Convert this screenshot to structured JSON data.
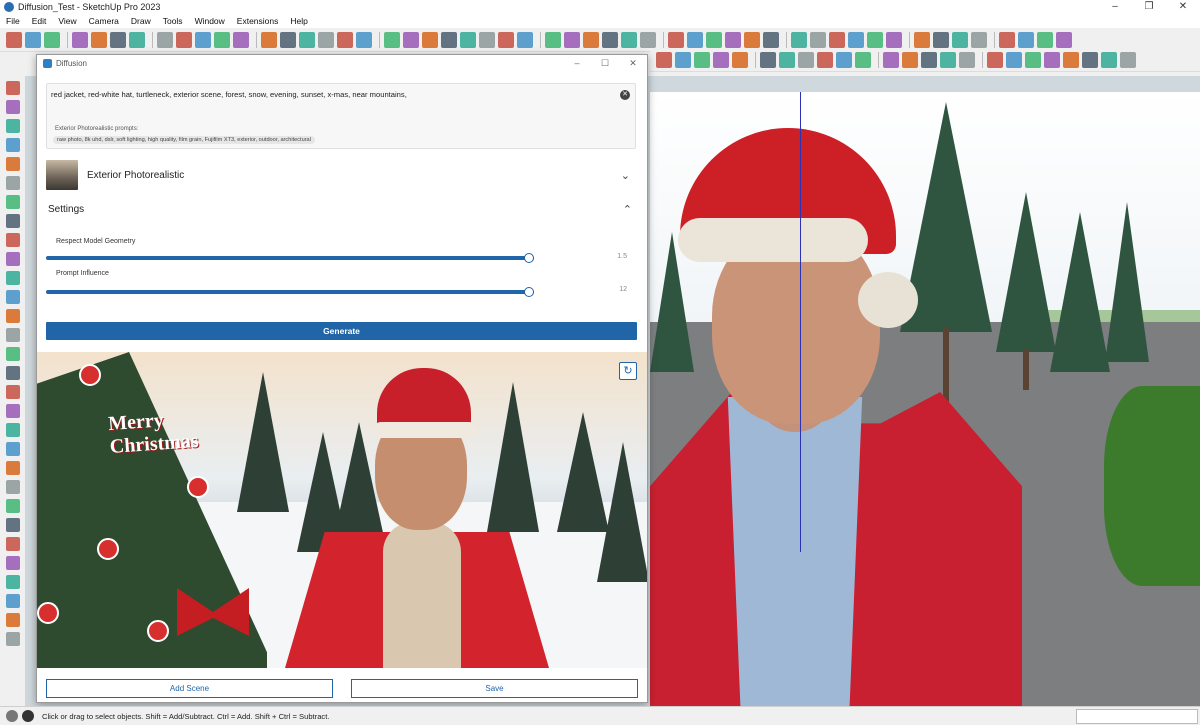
{
  "window": {
    "title": "Diffusion_Test - SketchUp Pro 2023",
    "controls": [
      "–",
      "❐",
      "✕"
    ]
  },
  "menu": [
    "File",
    "Edit",
    "View",
    "Camera",
    "Draw",
    "Tools",
    "Window",
    "Extensions",
    "Help"
  ],
  "dialog": {
    "title": "Diffusion",
    "controls": [
      "–",
      "☐",
      "✕"
    ],
    "prompt_text": "red jacket, red-white hat, turtleneck, exterior scene, forest, snow, evening, sunset, x-mas, near mountains,",
    "clear_icon": "✕",
    "hint_label": "Exterior Photorealistic prompts:",
    "hint_tag": "raw photo, 8k uhd, dslr, soft lighting, high quality, film grain, Fujifilm XT3, exterior, outdoor, architectural",
    "style_label": "Exterior Photorealistic",
    "style_chevron": "⌄",
    "settings_label": "Settings",
    "settings_chevron": "⌃",
    "sliders": [
      {
        "label": "Respect Model Geometry",
        "value": "1.5",
        "fraction": 0.99
      },
      {
        "label": "Prompt Influence",
        "value": "12",
        "fraction": 0.99
      }
    ],
    "generate_label": "Generate",
    "result_text_line1": "Merry",
    "result_text_line2": "Christmas",
    "refresh_icon": "↻",
    "add_scene_label": "Add Scene",
    "save_label": "Save"
  },
  "status": {
    "text": "Click or drag to select objects. Shift = Add/Subtract. Ctrl = Add. Shift + Ctrl = Subtract."
  },
  "colors": {
    "accent": "#1f65a8",
    "jacket": "#c82030"
  }
}
